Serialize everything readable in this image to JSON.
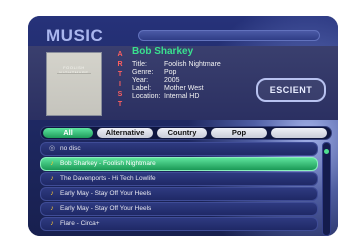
{
  "header": {
    "title": "MUSIC"
  },
  "artist_vertical": [
    "A",
    "R",
    "T",
    "I",
    "S",
    "T"
  ],
  "artist": {
    "name": "Bob Sharkey",
    "fields": [
      {
        "key": "Title:",
        "value": "Foolish Nightmare"
      },
      {
        "key": "Genre:",
        "value": "Pop"
      },
      {
        "key": "Year:",
        "value": "2005"
      },
      {
        "key": "Label:",
        "value": "Mother West"
      },
      {
        "key": "Location:",
        "value": "Internal HD"
      }
    ]
  },
  "album_art": {
    "text": "FOOLISH NIGHTMARE"
  },
  "brand": "ESCIENT",
  "filters": [
    {
      "label": "All",
      "active": true
    },
    {
      "label": "Alternative",
      "active": false
    },
    {
      "label": "Country",
      "active": false
    },
    {
      "label": "Pop",
      "active": false
    },
    {
      "label": "",
      "active": false
    }
  ],
  "list": [
    {
      "label": "no disc",
      "icon": "disc-icon",
      "selected": false
    },
    {
      "label": "Bob Sharkey - Foolish Nightmare",
      "icon": "music-note-icon",
      "selected": true
    },
    {
      "label": "The Davenports - Hi Tech Lowlife",
      "icon": "music-note-icon",
      "selected": false
    },
    {
      "label": "Early May - Stay Off Your Heels",
      "icon": "music-note-icon",
      "selected": false
    },
    {
      "label": "Early May - Stay Off Your Heels",
      "icon": "music-note-icon",
      "selected": false
    },
    {
      "label": "Flare - Circa+",
      "icon": "music-note-icon",
      "selected": false
    }
  ],
  "colors": {
    "accent": "#39e08f",
    "artist_label": "#ff5f5f",
    "background": "#1f2a63"
  }
}
